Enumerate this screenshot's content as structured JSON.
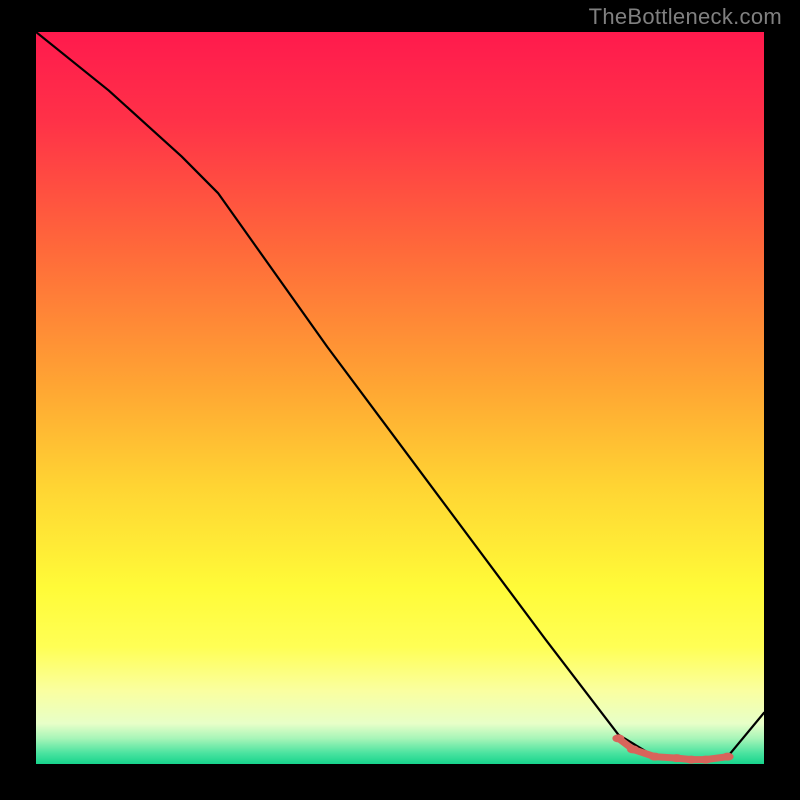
{
  "watermark": "TheBottleneck.com",
  "colors": {
    "frame": "#000000",
    "watermark_text": "#808080",
    "line_black": "#000000",
    "marker_red": "#d8645b",
    "gradient_stops": [
      {
        "offset": 0.0,
        "color": "#ff1a4d"
      },
      {
        "offset": 0.12,
        "color": "#ff3148"
      },
      {
        "offset": 0.3,
        "color": "#ff6a3a"
      },
      {
        "offset": 0.48,
        "color": "#ffa433"
      },
      {
        "offset": 0.62,
        "color": "#ffd433"
      },
      {
        "offset": 0.76,
        "color": "#fffb38"
      },
      {
        "offset": 0.84,
        "color": "#ffff55"
      },
      {
        "offset": 0.9,
        "color": "#faffa0"
      },
      {
        "offset": 0.945,
        "color": "#e7ffc8"
      },
      {
        "offset": 0.965,
        "color": "#a7f5b8"
      },
      {
        "offset": 0.985,
        "color": "#4be3a0"
      },
      {
        "offset": 1.0,
        "color": "#17d48c"
      }
    ]
  },
  "chart_data": {
    "type": "line",
    "title": "",
    "xlabel": "",
    "ylabel": "",
    "xlim": [
      0,
      100
    ],
    "ylim": [
      0,
      100
    ],
    "grid": false,
    "legend": false,
    "series": [
      {
        "name": "curve",
        "stroke": "line_black",
        "x": [
          0,
          10,
          20,
          25,
          40,
          55,
          70,
          80,
          85,
          90,
          95,
          100
        ],
        "y": [
          100,
          92,
          83,
          78,
          57,
          37,
          17,
          4,
          1,
          0.5,
          1,
          7
        ]
      },
      {
        "name": "optimum-markers",
        "stroke": "marker_red",
        "marker": true,
        "x": [
          80,
          82,
          85,
          88,
          90,
          92,
          95
        ],
        "y": [
          3.5,
          2,
          1,
          0.8,
          0.6,
          0.6,
          1.0
        ]
      }
    ]
  }
}
